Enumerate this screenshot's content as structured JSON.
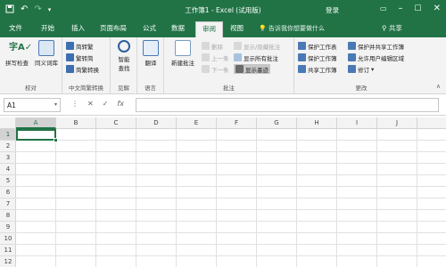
{
  "title_bar": {
    "title": "工作簿1 - Excel (试用版)",
    "login": "登录",
    "quick_access": {
      "save_icon": "save-icon",
      "undo_icon": "undo-icon",
      "redo_icon": "redo-icon",
      "customize_icon": "customize-icon"
    },
    "window_buttons": [
      "minimize",
      "maximize",
      "close"
    ]
  },
  "tabs": [
    "文件",
    "开始",
    "插入",
    "页面布局",
    "公式",
    "数据",
    "审阅",
    "视图"
  ],
  "active_tab": "审阅",
  "tell_me": "告诉我你想要做什么",
  "share": "共享",
  "ribbon": {
    "proofing": {
      "label": "校对",
      "spelling": "拼写检查",
      "thesaurus": "同义词库"
    },
    "chinese": {
      "label": "中文简繁转换",
      "to_traditional": "简转繁",
      "to_simplified": "繁转简",
      "convert": "简繁转换"
    },
    "insights": {
      "label": "见解",
      "smart_lookup_line1": "智能",
      "smart_lookup_line2": "查找"
    },
    "language": {
      "label": "语言",
      "translate": "翻译"
    },
    "comments": {
      "label": "批注",
      "new_comment": "新建批注",
      "delete": "删除",
      "previous": "上一条",
      "next": "下一条",
      "show_hide": "显示/隐藏批注",
      "show_all": "显示所有批注",
      "show_ink": "显示墨迹"
    },
    "changes": {
      "label": "更改",
      "protect_sheet": "保护工作表",
      "protect_workbook": "保护工作簿",
      "share_workbook": "共享工作簿",
      "protect_share": "保护并共享工作簿",
      "allow_edit_ranges": "允许用户编辑区域",
      "track_changes": "修订"
    }
  },
  "formula_bar": {
    "name_box": "A1",
    "cancel": "✕",
    "enter": "✓",
    "fx": "fx",
    "formula": ""
  },
  "grid": {
    "columns": [
      "A",
      "B",
      "C",
      "D",
      "E",
      "F",
      "G",
      "H",
      "I",
      "J"
    ],
    "rows": [
      "1",
      "2",
      "3",
      "4",
      "5",
      "6",
      "7",
      "8",
      "9",
      "10",
      "11",
      "12",
      "13"
    ],
    "selected_cell": "A1"
  },
  "colors": {
    "accent": "#217346"
  }
}
